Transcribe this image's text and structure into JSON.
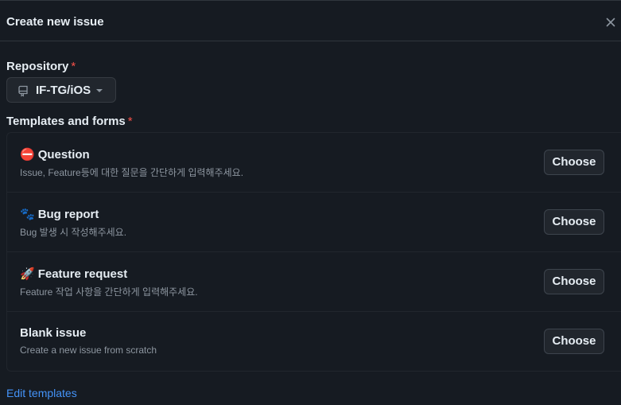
{
  "dialog": {
    "title": "Create new issue",
    "close_icon": "x-icon"
  },
  "repository": {
    "label": "Repository",
    "required_mark": "*",
    "selected": "IF-TG/iOS",
    "icon": "repo-icon"
  },
  "templates": {
    "label": "Templates and forms",
    "required_mark": "*",
    "items": [
      {
        "emoji": "⛔",
        "title": "Question",
        "description": "Issue, Feature등에 대한 질문을 간단하게 입력해주세요.",
        "button": "Choose"
      },
      {
        "emoji": "🐾",
        "title": "Bug report",
        "description": "Bug 발생 시 작성해주세요.",
        "button": "Choose"
      },
      {
        "emoji": "🚀",
        "title": "Feature request",
        "description": "Feature 작업 사항을 간단하게 입력해주세요.",
        "button": "Choose"
      },
      {
        "emoji": "",
        "title": "Blank issue",
        "description": "Create a new issue from scratch",
        "button": "Choose"
      }
    ]
  },
  "footer": {
    "edit_templates": "Edit templates"
  },
  "colors": {
    "background": "#161b22",
    "border": "#30363d",
    "text": "#e6edf3",
    "muted": "#8d96a0",
    "required": "#f85149",
    "link": "#4493f8",
    "button_bg": "#21262d"
  }
}
